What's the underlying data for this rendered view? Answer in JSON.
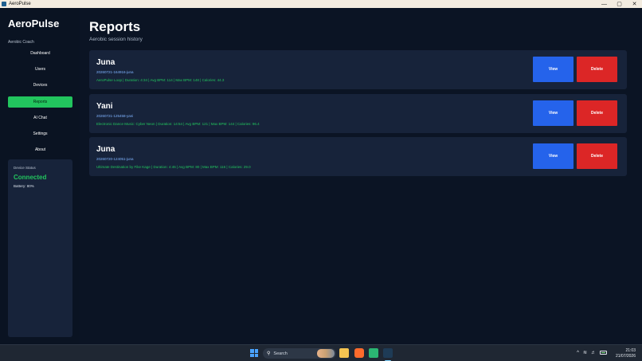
{
  "window": {
    "title": "AeroPulse",
    "controls": [
      "—",
      "▢",
      "✕"
    ]
  },
  "sidebar": {
    "brand": "AeroPulse",
    "subtitle": "Aerobic Coach",
    "items": [
      {
        "label": "Dashboard",
        "active": false
      },
      {
        "label": "Users",
        "active": false
      },
      {
        "label": "Devices",
        "active": false
      },
      {
        "label": "Reports",
        "active": true
      },
      {
        "label": "AI Chat",
        "active": false
      },
      {
        "label": "Settings",
        "active": false
      },
      {
        "label": "About",
        "active": false
      }
    ],
    "device_status": {
      "title": "Device Status",
      "value": "Connected",
      "battery": "Battery: 80%"
    }
  },
  "main": {
    "title": "Reports",
    "subtitle": "Aerobic session history",
    "reports": [
      {
        "name": "Juna",
        "id": "20260721-164916-juna",
        "summary": "AeroPulse Loop | Duration: 4:34 | Avg BPM: 114 | Max BPM: 148 | Calories: 44.3",
        "view_label": "View",
        "delete_label": "Delete"
      },
      {
        "name": "Yani",
        "id": "20260721-125458-yani",
        "summary": "Electronic Dance Music: Cyber Neon | Duration: 14:54 | Avg BPM: 121 | Max BPM: 144 | Calories: 96.4",
        "view_label": "View",
        "delete_label": "Delete"
      },
      {
        "name": "Juna",
        "id": "20260720-124051-juna",
        "summary": "Ultimate Destination by Fike Kage | Duration: 4:46 | Avg BPM: 80 | Max BPM: 116 | Calories: 29.0",
        "view_label": "View",
        "delete_label": "Delete"
      }
    ]
  },
  "taskbar": {
    "search_placeholder": "Search",
    "tray": {
      "chevron": "^",
      "wifi": "wifi-icon",
      "volume": "speaker-icon",
      "battery": "battery-icon"
    },
    "clock_time": "21:03",
    "clock_date": "21/07/2026"
  },
  "colors": {
    "accent_green": "#22c55e",
    "view_blue": "#2563eb",
    "delete_red": "#dc2626",
    "card_bg": "#17233a",
    "page_bg": "#0b1424"
  }
}
